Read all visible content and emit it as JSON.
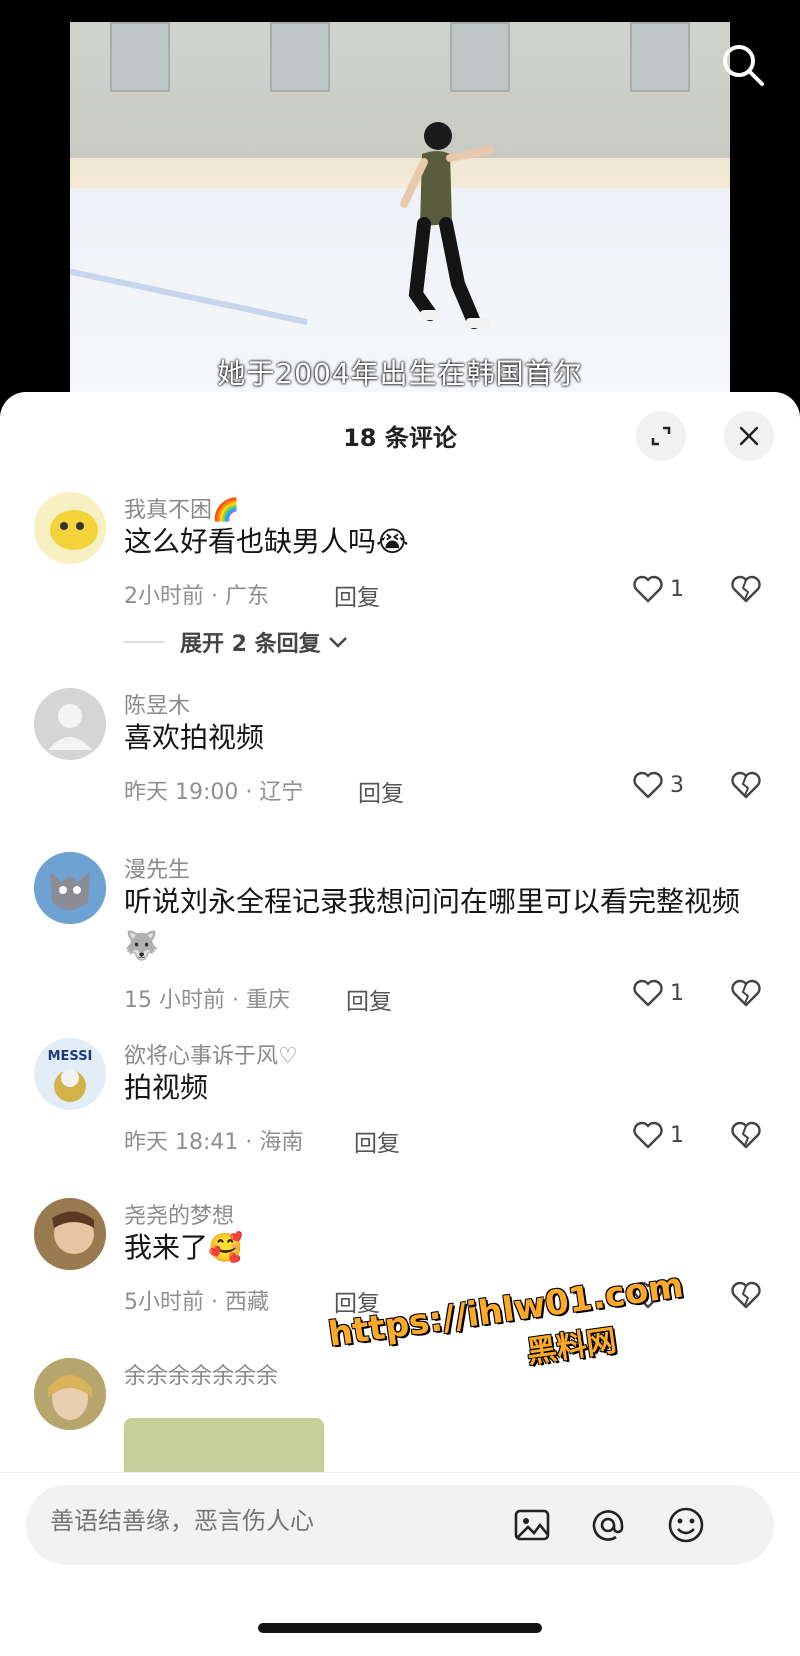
{
  "video": {
    "caption": "她于2004年出生在韩国首尔"
  },
  "sheet": {
    "title": "18 条评论"
  },
  "comments": [
    {
      "name": "我真不困🌈",
      "text": "这么好看也缺男人吗😭",
      "meta": "2小时前 · 广东",
      "reply": "回复",
      "likes": "1",
      "expand": "展开 2 条回复"
    },
    {
      "name": "陈昱木",
      "text": "喜欢拍视频",
      "meta": "昨天 19:00 · 辽宁",
      "reply": "回复",
      "likes": "3"
    },
    {
      "name": "漫先生",
      "text": "听说刘永全程记录我想问问在哪里可以看完整视频🐺",
      "meta": "15 小时前 · 重庆",
      "reply": "回复",
      "likes": "1"
    },
    {
      "name": "欲将心事诉于风♡",
      "text": "拍视频",
      "meta": "昨天 18:41 · 海南",
      "reply": "回复",
      "likes": "1",
      "avatar_text": "MESSI"
    },
    {
      "name": "尧尧的梦想",
      "text": "我来了🥰",
      "meta": "5小时前 · 西藏",
      "reply": "回复",
      "likes": ""
    },
    {
      "name": "余余余余余余余"
    }
  ],
  "input": {
    "placeholder": "善语结善缘，恶言伤人心"
  },
  "watermark": {
    "line1": "https://ihlw01.com",
    "line2": "黑料网"
  },
  "colors": {
    "sheet_bg": "#ffffff",
    "input_bg": "#f2f2f2",
    "watermark": "#ffa928"
  }
}
